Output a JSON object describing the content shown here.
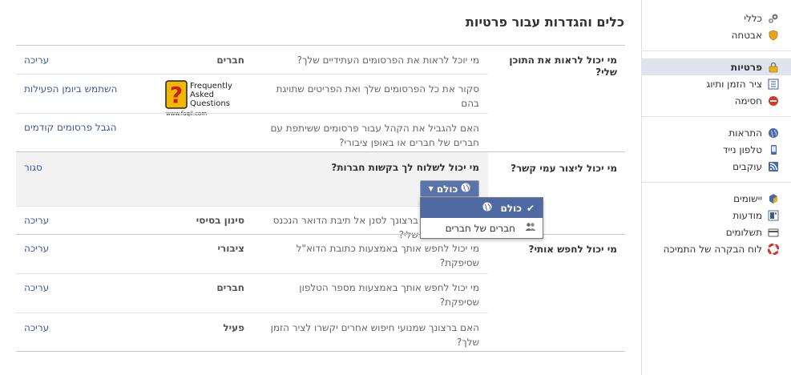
{
  "page": {
    "title": "כלים והגדרות עבור פרטיות"
  },
  "sidebar": {
    "groups": [
      [
        {
          "label": "כללי",
          "icon": "gears-icon",
          "active": false
        },
        {
          "label": "אבטחה",
          "icon": "shield-icon",
          "active": false
        }
      ],
      [
        {
          "label": "פרטיות",
          "icon": "lock-icon",
          "active": true
        },
        {
          "label": "ציר הזמן ותיוג",
          "icon": "timeline-icon",
          "active": false
        },
        {
          "label": "חסימה",
          "icon": "block-icon",
          "active": false
        }
      ],
      [
        {
          "label": "התראות",
          "icon": "globe-icon",
          "active": false
        },
        {
          "label": "טלפון נייד",
          "icon": "mobile-icon",
          "active": false
        },
        {
          "label": "עוקבים",
          "icon": "rss-icon",
          "active": false
        }
      ],
      [
        {
          "label": "יישומים",
          "icon": "apps-icon",
          "active": false
        },
        {
          "label": "מודעות",
          "icon": "ads-icon",
          "active": false
        },
        {
          "label": "תשלומים",
          "icon": "card-icon",
          "active": false
        },
        {
          "label": "לוח הבקרה של התמיכה",
          "icon": "lifebuoy-icon",
          "active": false
        }
      ]
    ]
  },
  "sections": {
    "see_content": {
      "label": "מי יכול לראות את התוכן שלי?",
      "rows": [
        {
          "question": "מי יוכל לראות את הפרסומים העתידיים שלך?",
          "value": "חברים",
          "action": "עריכה"
        },
        {
          "question": "סקור את כל הפרסומים שלך ואת הפריטים שתויגת בהם",
          "value": "",
          "action": "השתמש ביומן הפעילות"
        },
        {
          "question": "האם להגביל את הקהל עבור פרסומים ששיתפת עם חברים של חברים או באופן ציבורי?",
          "value": "",
          "action": "הגבל פרסומים קודמים"
        }
      ]
    },
    "contact": {
      "label": "מי יכול ליצור עמי קשר?",
      "expanded_question": "מי יכול לשלוח לך בקשות חברות?",
      "close_label": "סגור",
      "audience_button": "כולם",
      "audience_options": [
        {
          "label": "כולם",
          "icon": "globe-icon",
          "selected": true
        },
        {
          "label": "חברים של חברים",
          "icon": "friends-icon",
          "selected": false
        }
      ],
      "filter_row": {
        "question": "ברצונך לסנן אל תיבת הדואר הנכנס שלי?",
        "value": "סינון בסיסי",
        "action": "עריכה"
      }
    },
    "lookup": {
      "label": "מי יכול לחפש אותי?",
      "rows": [
        {
          "question": "מי יכול לחפש אותך באמצעות כתובת הדוא\"ל שסיפקת?",
          "value": "ציבורי",
          "action": "עריכה"
        },
        {
          "question": "מי יכול לחפש אותך באמצעות מספר הטלפון שסיפקת?",
          "value": "חברים",
          "action": "עריכה"
        },
        {
          "question": "האם ברצונך שמנועי חיפוש אחרים יקשרו לציר הזמן שלך?",
          "value": "פעיל",
          "action": "עריכה"
        }
      ]
    }
  },
  "faq_logo": {
    "line1": "Frequently",
    "line2": "Asked",
    "line3": "Questions",
    "url": "www.faqil.com",
    "colors": {
      "yellow": "#f2b705",
      "red": "#c81e1e"
    }
  },
  "colors": {
    "link": "#3b5998",
    "selected": "#4f6aa3",
    "active_sidebar": "#dfe3ee"
  }
}
